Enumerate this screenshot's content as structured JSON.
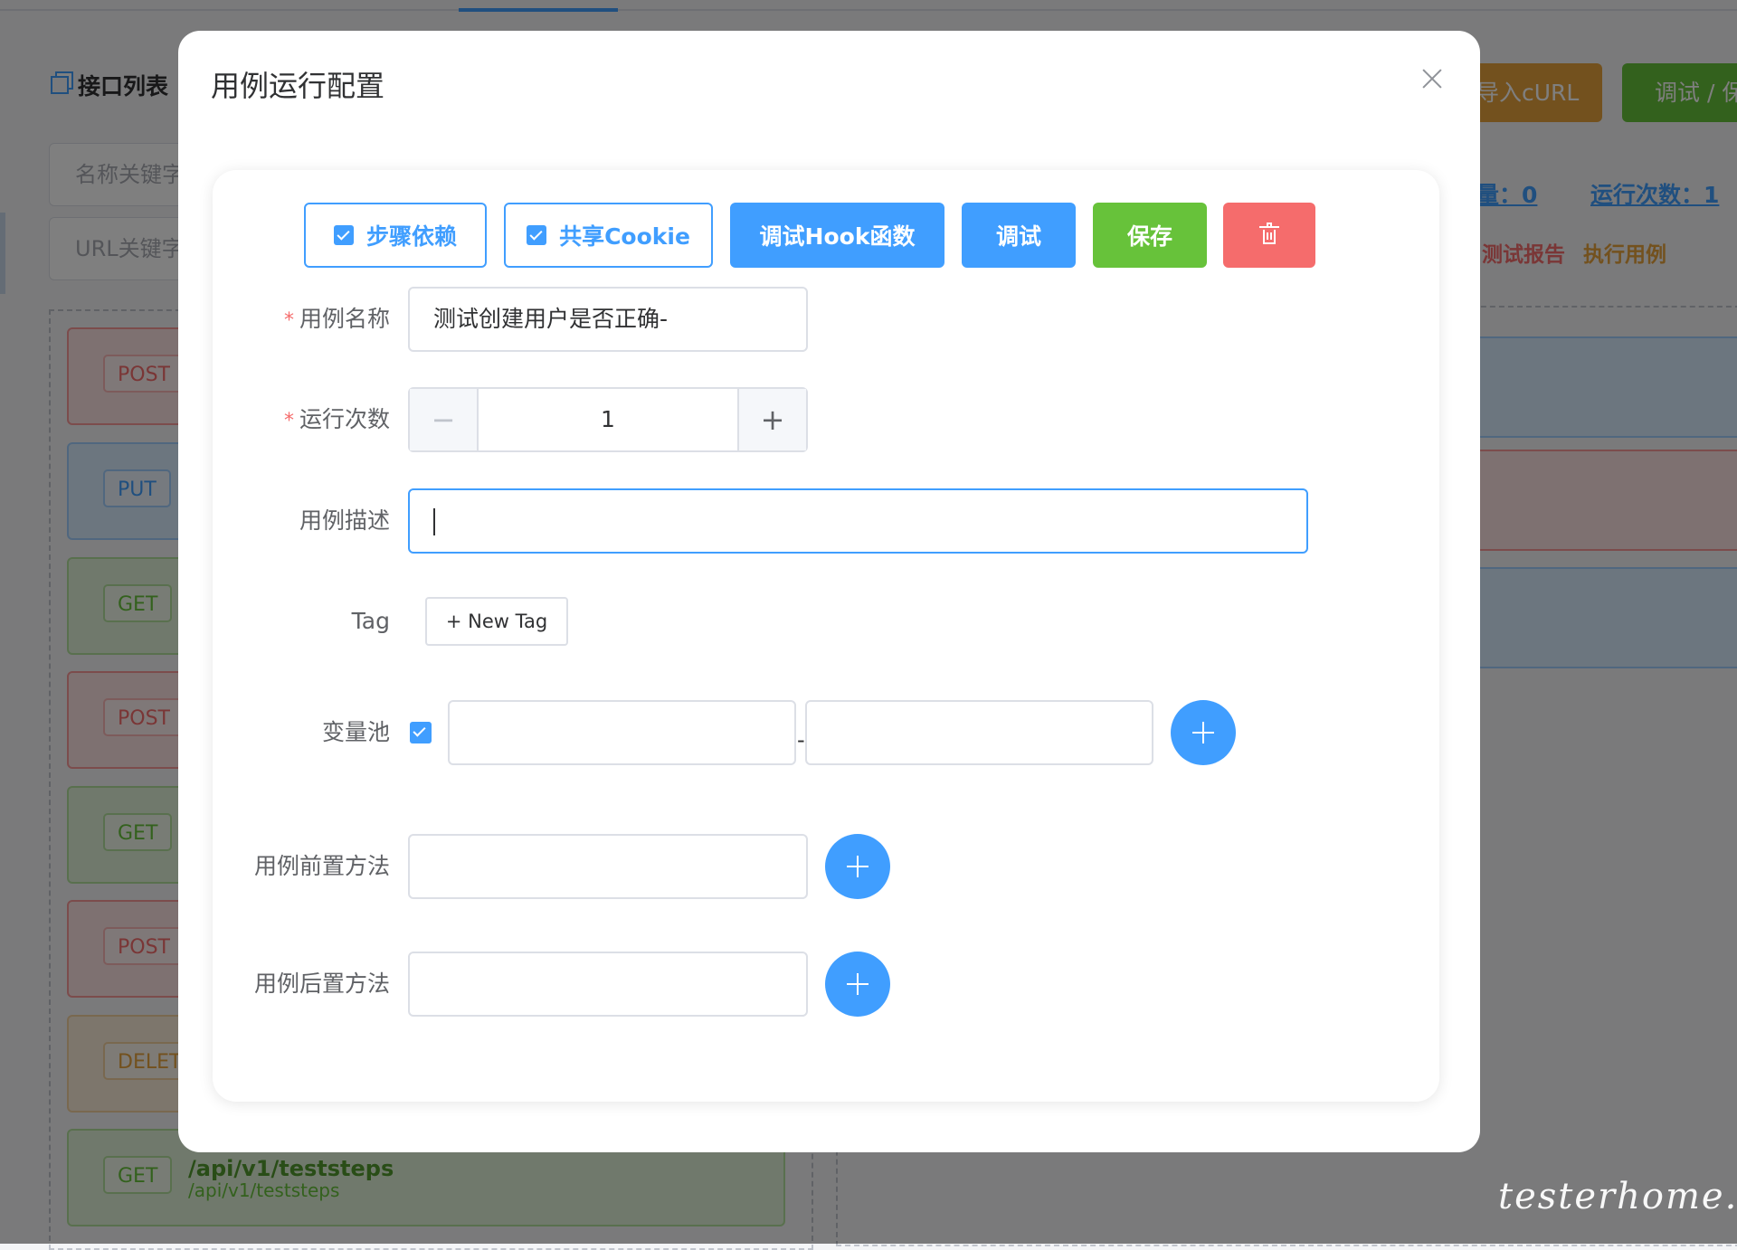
{
  "background": {
    "panel_title": "接口列表",
    "name_search_placeholder": "名称关键字",
    "url_search_placeholder": "URL关键字",
    "api_items": [
      {
        "method": "POST"
      },
      {
        "method": "PUT"
      },
      {
        "method": "GET"
      },
      {
        "method": "POST"
      },
      {
        "method": "GET"
      },
      {
        "method": "POST"
      },
      {
        "method": "DELET"
      },
      {
        "method": "GET",
        "path": "/api/v1/teststeps",
        "sub_path": "/api/v1/teststeps"
      }
    ],
    "import_curl_label": "导入cURL",
    "debug_save_label": "调试 / 保",
    "stat_count_label": "量：0",
    "run_count_label": "运行次数：1",
    "test_report_label": "测试报告",
    "run_case_label": "执行用例",
    "watermark": "testerhome.com",
    "colors": {
      "warning": "#e6a23c",
      "success_dark": "#529b2e"
    }
  },
  "dialog": {
    "title": "用例运行配置",
    "close_icon": "close-icon",
    "toolbar": {
      "step_dependency_label": "步骤依赖",
      "step_dependency_checked": true,
      "share_cookie_label": "共享Cookie",
      "share_cookie_checked": true,
      "debug_hook_label": "调试Hook函数",
      "debug_label": "调试",
      "save_label": "保存",
      "delete_icon": "trash-icon"
    },
    "form": {
      "case_name_label": "用例名称",
      "case_name_value": "测试创建用户是否正确-",
      "run_times_label": "运行次数",
      "run_times_value": "1",
      "case_desc_label": "用例描述",
      "case_desc_value": "",
      "tag_label": "Tag",
      "new_tag_label": "+ New Tag",
      "var_pool_label": "变量池",
      "var_pool_checked": true,
      "var_pool_key": "",
      "var_pool_separator": "-",
      "var_pool_value": "",
      "setup_label": "用例前置方法",
      "setup_value": "",
      "teardown_label": "用例后置方法",
      "teardown_value": ""
    },
    "colors": {
      "primary": "#409eff",
      "success": "#67c23a",
      "danger": "#f56c6c"
    }
  }
}
